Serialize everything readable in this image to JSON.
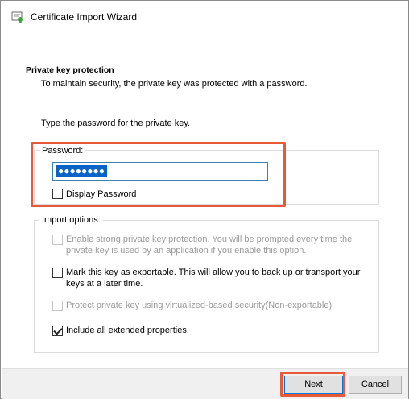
{
  "window": {
    "title": "Certificate Import Wizard"
  },
  "header": {
    "section_title": "Private key protection",
    "section_description": "To maintain security, the private key was protected with a password."
  },
  "password_section": {
    "prompt": "Type the password for the private key.",
    "group_label": "Password:",
    "masked_value": "●●●●●●●●",
    "display_password_label": "Display Password",
    "display_password_checked": false
  },
  "import_options": {
    "group_label": "Import options:",
    "options": [
      {
        "line1": "Enable strong private key protection. You will be prompted every time the",
        "line2": "private key is used by an application if you enable this option.",
        "checked": false,
        "enabled": false
      },
      {
        "line1": "Mark this key as exportable. This will allow you to back up or transport your",
        "line2": "keys at a later time.",
        "checked": false,
        "enabled": true
      },
      {
        "line1": "Protect private key using virtualized-based security(Non-exportable)",
        "line2": "",
        "checked": false,
        "enabled": false
      },
      {
        "line1": "Include all extended properties.",
        "line2": "",
        "checked": true,
        "enabled": true
      }
    ]
  },
  "footer": {
    "next_label": "Next",
    "cancel_label": "Cancel"
  },
  "colors": {
    "highlight": "#e8593a",
    "selection": "#0a64c8",
    "focus_border": "#0078d7"
  }
}
